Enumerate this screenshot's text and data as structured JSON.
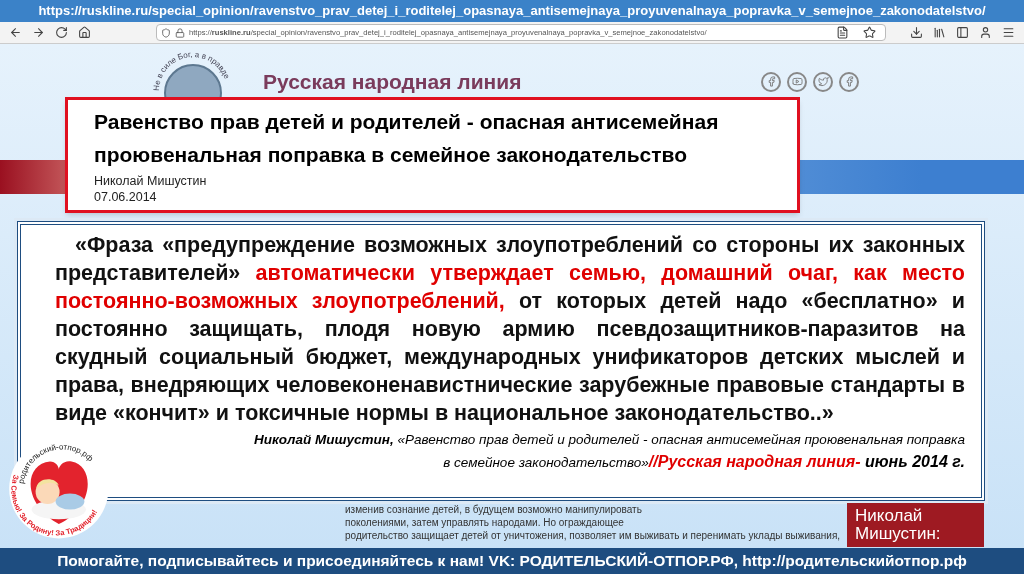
{
  "banner_url": "https://ruskline.ru/special_opinion/ravenstvo_prav_detej_i_roditelej_opasnaya_antisemejnaya_proyuvenalnaya_popravka_v_semejnoe_zakonodatelstvo/",
  "browser": {
    "address": "https://**ruskline.ru**/special_opinion/ravenstvo_prav_detej_i_roditelej_opasnaya_antisemejnaya_proyuvenalnaya_popravka_v_semejnoe_zakonodatelstvo/"
  },
  "site": {
    "motto": "Не в силе Бог, а в правде",
    "title": "Русская народная линия"
  },
  "article": {
    "title": "Равенство прав детей и родителей - опасная антисемейная проювенальная поправка в семейное законодательство",
    "author": "Николай Мишустин",
    "date": "07.06.2014"
  },
  "quote": {
    "parts": [
      {
        "text": "«Фраза «предупреждение возможных злоупотреблений со стороны их законных представителей» ",
        "highlight": false
      },
      {
        "text": "автоматически утверждает семью, домашний очаг, как место постоянно-возможных злоупотреблений,",
        "highlight": true
      },
      {
        "text": " от которых детей надо «бесплатно» и постоянно защищать, плодя новую армию псевдозащитников-паразитов на скудный социальный бюджет, международных унификаторов детских мыслей и права, внедряющих человеконенавистнические зарубежные правовые стандарты в виде «кончит» и токсичные нормы в национальное законодательство..»",
        "highlight": false
      }
    ],
    "citation": [
      {
        "text": "Николай Мишустин,",
        "kind": "author"
      },
      {
        "text": " «Равенство прав детей и родителей - опасная антисемейная проювенальная поправка в семейное законодательство»",
        "kind": "plain"
      },
      {
        "text": "//Русская народная линия-",
        "kind": "source"
      },
      {
        "text": " июнь 2014 г.",
        "kind": "date"
      }
    ]
  },
  "background_text": [
    "изменив сознание детей, в будущем возможно манипулировать",
    "поколениями, затем управлять народами. Но ограждающее",
    "родительство защищает детей от уничтожения, позволяет им выживать и перенимать уклады выживания,"
  ],
  "side_box": "Николай Мишустин:",
  "logo": {
    "top_text": "родительский-отпор.рф",
    "bottom_text": "За Семью! За Родину! За Традиции!"
  },
  "footer": "Помогайте, подписывайтесь и присоединяйтесь к нам! VK: РОДИТЕЛЬСКИЙ-ОТПОР.РФ, http://родительскийотпор.рф"
}
